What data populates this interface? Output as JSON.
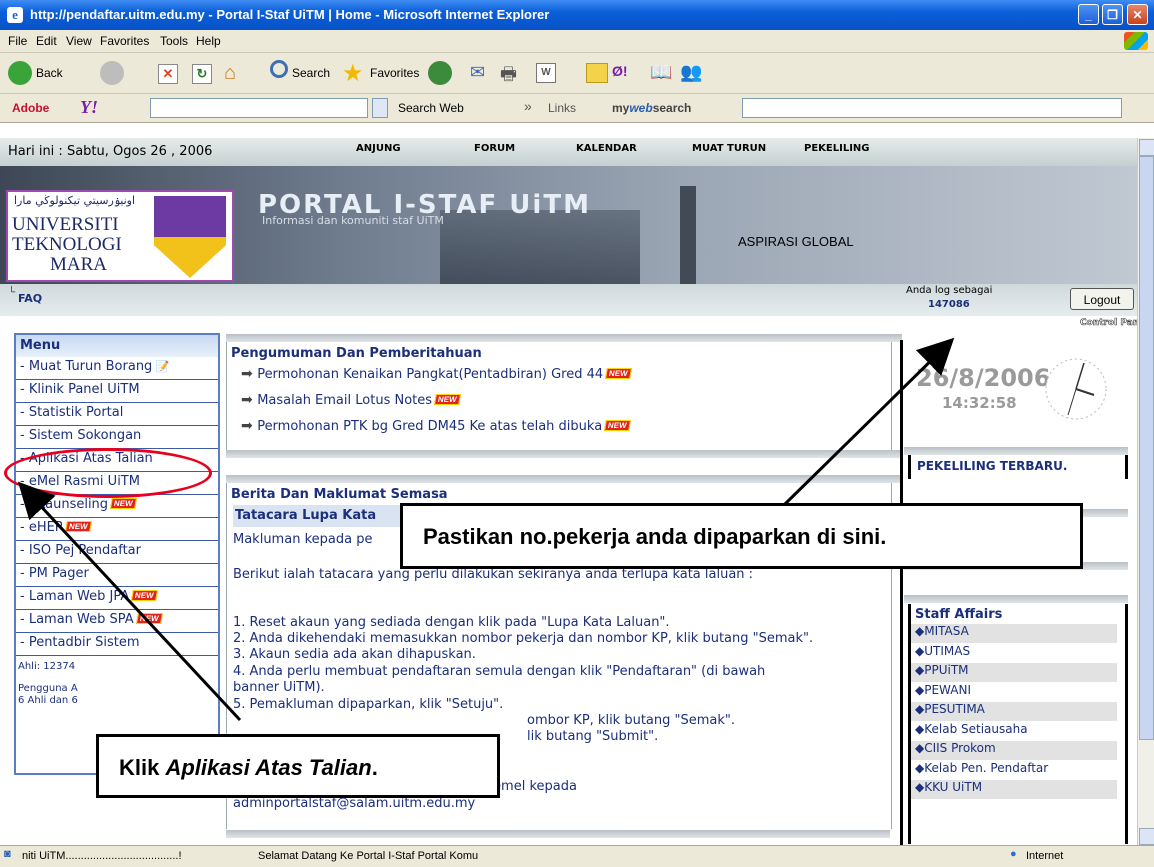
{
  "window": {
    "title": "http://pendaftar.uitm.edu.my - Portal I-Staf UiTM | Home - Microsoft Internet Explorer",
    "buttons": {
      "minimize": "_",
      "maximize": "❐",
      "close": "✕"
    }
  },
  "menubar": [
    "File",
    "Edit",
    "View",
    "Favorites",
    "Tools",
    "Help"
  ],
  "toolbar": {
    "back": "Back",
    "search": "Search",
    "favorites": "Favorites"
  },
  "addonbar": {
    "adobe": "Adobe",
    "yahoo": "Y!",
    "search_web": "Search Web",
    "links": "Links",
    "mywebsearch_my": "my",
    "mywebsearch_web": "web",
    "mywebsearch_search": "search",
    "chevron": "»"
  },
  "page": {
    "date": "Hari ini : Sabtu, Ogos 26 , 2006",
    "nav": [
      "ANJUNG",
      "FORUM",
      "KALENDAR",
      "MUAT TURUN",
      "PEKELILING"
    ],
    "logo": {
      "jawi": "اونيۏرسيتي تيكنولوڬي مارا",
      "line1": "UNIVERSITI",
      "line2": "TEKNOLOGI",
      "line3": "MARA"
    },
    "portal_title": "PORTAL I-STAF UiTM",
    "portal_subtitle": "Informasi dan komuniti staf UiTM",
    "aspirasi": "ASPIRASI GLOBAL",
    "faq": "FAQ",
    "login_label": "Anda log sebagai",
    "login_id": "147086",
    "logout": "Logout",
    "control_panel": "Control Panel"
  },
  "menu": {
    "header": "Menu",
    "items": [
      {
        "label": "- Muat Turun Borang",
        "new": false
      },
      {
        "label": "- Klinik Panel UiTM",
        "new": false
      },
      {
        "label": "- Statistik Portal",
        "new": false
      },
      {
        "label": "- Sistem Sokongan",
        "new": false
      },
      {
        "label": "- Aplikasi Atas Talian",
        "new": false
      },
      {
        "label": "- eMel Rasmi UiTM",
        "new": false
      },
      {
        "label": "- eKaunseling",
        "new": true
      },
      {
        "label": "- eHEP",
        "new": true
      },
      {
        "label": "- ISO Pej Pendaftar",
        "new": false
      },
      {
        "label": "- PM Pager",
        "new": false
      },
      {
        "label": "- Laman Web JPA",
        "new": true
      },
      {
        "label": "- Laman Web SPA",
        "new": true
      },
      {
        "label": "- Pentadbir Sistem",
        "new": false
      }
    ],
    "ahli": "Ahli: 12374",
    "pengguna": "Pengguna A",
    "ahli_dan": "6 Ahli dan 6"
  },
  "new_badge": "NEW",
  "announcements": {
    "title": "Pengumuman Dan Pemberitahuan",
    "items": [
      "Permohonan Kenaikan Pangkat(Pentadbiran) Gred 44",
      "Masalah Email Lotus Notes",
      "Permohonan PTK bg Gred DM45 Ke atas telah dibuka"
    ]
  },
  "news": {
    "title": "Berita Dan Maklumat Semasa",
    "subtitle": "Tatacara Lupa Kata",
    "intro": "Makluman kepada pe",
    "lead": "Berikut ialah tatacara yang perlu dilakukan sekiranya anda terlupa kata laluan :",
    "steps": [
      "1. Reset akaun yang sediada dengan klik pada \"Lupa Kata Laluan\".",
      "2. Anda dikehendaki memasukkan nombor pekerja dan nombor KP, klik butang \"Semak\".",
      "3. Akaun sedia ada akan dihapuskan.",
      "4. Anda perlu membuat pendaftaran semula dengan klik \"Pendaftaran\" (di bawah",
      "banner UiTM).",
      "5. Pemakluman dipaparkan, klik \"Setuju\".",
      "ombor KP, klik butang \"Semak\".",
      "lik butang \"Submit\".",
      "sekiranya masih terdapat masalah, sila emel kepada",
      "adminportalstaf@salam.uitm.edu.my"
    ]
  },
  "clock": {
    "date": "26/8/2006",
    "time": "14:32:58"
  },
  "pekeliling": "PEKELILING TERBARU.",
  "staff_affairs": {
    "title": "Staff Affairs",
    "items": [
      "◆MITASA",
      "◆UTIMAS",
      "◆PPUiTM",
      "◆PEWANI",
      "◆PESUTIMA",
      "◆Kelab Setiausaha",
      "◆CIIS Prokom",
      "◆Kelab Pen. Pendaftar",
      "◆KKU UiTM"
    ]
  },
  "callouts": {
    "right": "Pastikan no.pekerja anda dipaparkan di sini.",
    "left_prefix": "Klik ",
    "left_italic": "Aplikasi Atas Talian",
    "left_suffix": "."
  },
  "statusbar": {
    "left": "niti UiTM.....................................!",
    "middle": "Selamat Datang Ke Portal I-Staf Portal Komu",
    "zone": "Internet"
  },
  "colors": {
    "title_blue": "#0a5fd8",
    "link_blue": "#1b2f7a",
    "menu_border": "#3c5aa8",
    "new_red": "#e2231a",
    "highlight_red": "#e8001c"
  }
}
